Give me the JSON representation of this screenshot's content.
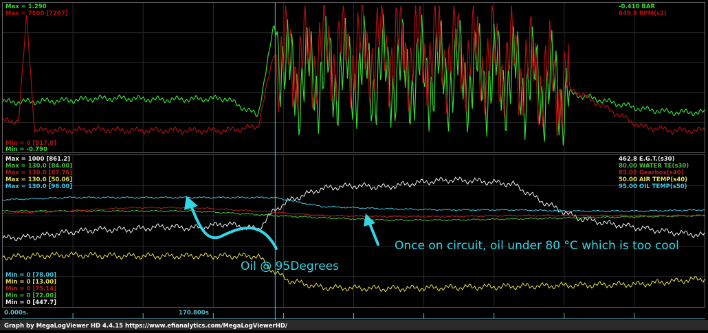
{
  "footer": {
    "credit": "Graph by MegaLogViewer HD 4.4.15 https://www.efianalytics.com/MegaLogViewerHD/",
    "start_time": "0.000s.",
    "cursor_time": "170.800s"
  },
  "colors": {
    "background": "#000000",
    "grid": "#2a2a2a",
    "cursor": "#5fb7c9",
    "bar": "#33dd33",
    "rpm": "#b01010",
    "egt": "#f2f2f2",
    "water": "#46bf3a",
    "gearbox": "#b02020",
    "air": "#e8e050",
    "oil": "#40c8e8",
    "annotation": "#33d6e6"
  },
  "top_panel": {
    "left_labels": [
      {
        "text": "Max = 1.290",
        "color": "#33dd33"
      },
      {
        "text": "Max = 7500 [7267]",
        "color": "#b01010"
      }
    ],
    "left_min_labels": [
      {
        "text": "Min = 0 [517.8]",
        "color": "#b01010"
      },
      {
        "text": "Min = -0.790",
        "color": "#33dd33"
      }
    ],
    "right_labels": [
      {
        "text": "-0.410  BAR",
        "color": "#33dd33"
      },
      {
        "text": "849.8  RPM(s2)",
        "color": "#b01010"
      }
    ]
  },
  "bottom_panel": {
    "left_max_labels": [
      {
        "text": "Max = 1000 [861.2]",
        "color": "#f2f2f2"
      },
      {
        "text": "Max = 130.0 [84.00]",
        "color": "#46bf3a"
      },
      {
        "text": "Max = 130.0 [87.76]",
        "color": "#b02020"
      },
      {
        "text": "Max = 130.0 [50.06]",
        "color": "#e8e050"
      },
      {
        "text": "Max = 130.0 [96.00]",
        "color": "#40c8e8"
      }
    ],
    "left_min_labels": [
      {
        "text": "Min = 0 [78.00]",
        "color": "#40c8e8"
      },
      {
        "text": "Min = 0 [13.00]",
        "color": "#e8e050"
      },
      {
        "text": "Min = 0 [75.14]",
        "color": "#b02020"
      },
      {
        "text": "Min = 0 [72.00]",
        "color": "#46bf3a"
      },
      {
        "text": "Min = 0 [447.7]",
        "color": "#f2f2f2"
      }
    ],
    "right_labels": [
      {
        "text": "462.8  E.G.T.(s30)",
        "color": "#f2f2f2"
      },
      {
        "text": "80.00  WATER TE(s30)",
        "color": "#46bf3a"
      },
      {
        "text": "85.02  Gearbox(s40)",
        "color": "#b02020"
      },
      {
        "text": "50.00  AIR TEMP(s40)",
        "color": "#e8e050"
      },
      {
        "text": "95.00  OIL TEMP(s50)",
        "color": "#40c8e8"
      }
    ]
  },
  "annotations": {
    "oil_start": "Oil @ 95Degrees",
    "oil_circuit": "Once on circuit, oil under 80 °C which is too cool"
  },
  "chart_data": [
    {
      "type": "line",
      "x_range_s": [
        0,
        440
      ],
      "cursor_s": 170.8,
      "series": [
        {
          "name": "BAR",
          "ylim": [
            -0.79,
            1.29
          ],
          "x": [
            0,
            10,
            40,
            60,
            80,
            100,
            120,
            140,
            160,
            170,
            180,
            200,
            240,
            280,
            320,
            360,
            400,
            420,
            440
          ],
          "values": [
            -0.1,
            -0.1,
            -0.08,
            -0.05,
            -0.05,
            -0.07,
            -0.06,
            -0.05,
            -0.3,
            1.0,
            0.2,
            0.3,
            0.3,
            0.3,
            0.25,
            0.0,
            -0.2,
            -0.25,
            -0.25
          ]
        },
        {
          "name": "RPM(s2)",
          "ylim": [
            0,
            7500
          ],
          "x": [
            0,
            10,
            15,
            20,
            40,
            60,
            80,
            100,
            120,
            140,
            160,
            170,
            180,
            200,
            240,
            280,
            320,
            360,
            400,
            420,
            440
          ],
          "values": [
            1500,
            1500,
            7000,
            1000,
            1000,
            1050,
            1000,
            1000,
            1000,
            1000,
            1200,
            5000,
            4500,
            5000,
            5200,
            5000,
            4500,
            3000,
            1200,
            1000,
            1000
          ]
        }
      ]
    },
    {
      "type": "line",
      "x_range_s": [
        0,
        440
      ],
      "cursor_s": 170.8,
      "series": [
        {
          "name": "E.G.T.(s30)",
          "ylim": [
            0,
            1000
          ],
          "x": [
            0,
            20,
            40,
            60,
            80,
            100,
            120,
            140,
            160,
            170,
            180,
            200,
            220,
            240,
            260,
            280,
            300,
            320,
            340,
            360,
            380,
            400,
            420,
            440
          ],
          "values": [
            460,
            470,
            500,
            520,
            520,
            540,
            530,
            560,
            520,
            650,
            720,
            800,
            820,
            810,
            840,
            860,
            850,
            830,
            700,
            600,
            560,
            530,
            500,
            480
          ]
        },
        {
          "name": "WATER TE(s30)",
          "ylim": [
            0,
            130
          ],
          "x": [
            0,
            40,
            80,
            120,
            170,
            200,
            240,
            280,
            320,
            360,
            400,
            440
          ],
          "values": [
            84,
            84,
            84,
            84,
            80,
            78,
            76,
            76,
            77,
            78,
            79,
            80
          ]
        },
        {
          "name": "Gearbox(s40)",
          "ylim": [
            0,
            130
          ],
          "x": [
            0,
            40,
            80,
            120,
            170,
            200,
            240,
            280,
            320,
            360,
            400,
            440
          ],
          "values": [
            82,
            84,
            87,
            87,
            83,
            80,
            79,
            79,
            80,
            80,
            80,
            80
          ]
        },
        {
          "name": "AIR TEMP(s40)",
          "ylim": [
            0,
            130
          ],
          "x": [
            0,
            40,
            80,
            120,
            160,
            170,
            180,
            200,
            240,
            280,
            320,
            360,
            400,
            440
          ],
          "values": [
            43,
            45,
            44,
            44,
            44,
            30,
            22,
            16,
            15,
            16,
            17,
            18,
            19,
            24
          ]
        },
        {
          "name": "OIL TEMP(s50)",
          "ylim": [
            0,
            130
          ],
          "x": [
            0,
            40,
            80,
            120,
            170,
            200,
            240,
            280,
            320,
            360,
            400,
            440
          ],
          "values": [
            94,
            96,
            96,
            96,
            96,
            88,
            86,
            85,
            85,
            84,
            84,
            85
          ]
        }
      ]
    }
  ]
}
